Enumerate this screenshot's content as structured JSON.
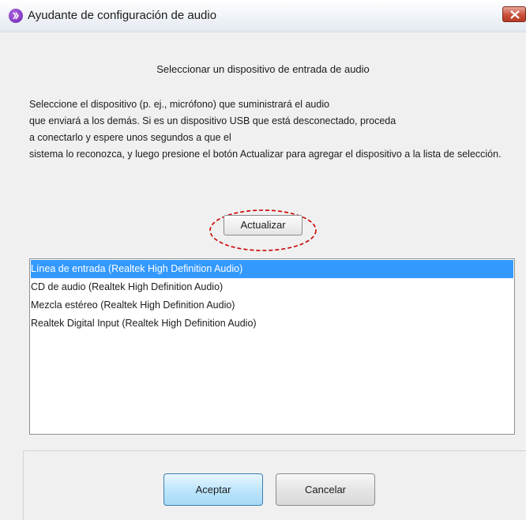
{
  "window": {
    "title": "Ayudante de configuración de audio",
    "close_label": "X"
  },
  "subtitle": "Seleccionar un dispositivo de entrada de audio",
  "description": [
    "Seleccione el dispositivo (p. ej., micrófono) que suministrará el audio",
    "que enviará a los demás. Si es un dispositivo USB que está desconectado, proceda",
    "a conectarlo y espere unos segundos a que el",
    "sistema lo reconozca, y luego presione el botón Actualizar para agregar el dispositivo a la lista de selección."
  ],
  "refresh_button": "Actualizar",
  "devices": [
    {
      "label": "Línea de entrada (Realtek High Definition Audio)",
      "selected": true
    },
    {
      "label": "CD de audio (Realtek High Definition Audio)",
      "selected": false
    },
    {
      "label": "Mezcla estéreo (Realtek High Definition Audio)",
      "selected": false
    },
    {
      "label": "Realtek Digital Input (Realtek High Definition Audio)",
      "selected": false
    }
  ],
  "buttons": {
    "ok": "Aceptar",
    "cancel": "Cancelar"
  },
  "colors": {
    "selection": "#3399ff",
    "highlight_ring": "#cc0000",
    "app_icon": "#7b2cbf"
  },
  "icons": {
    "app": "app-logo-icon",
    "close": "close-icon"
  }
}
